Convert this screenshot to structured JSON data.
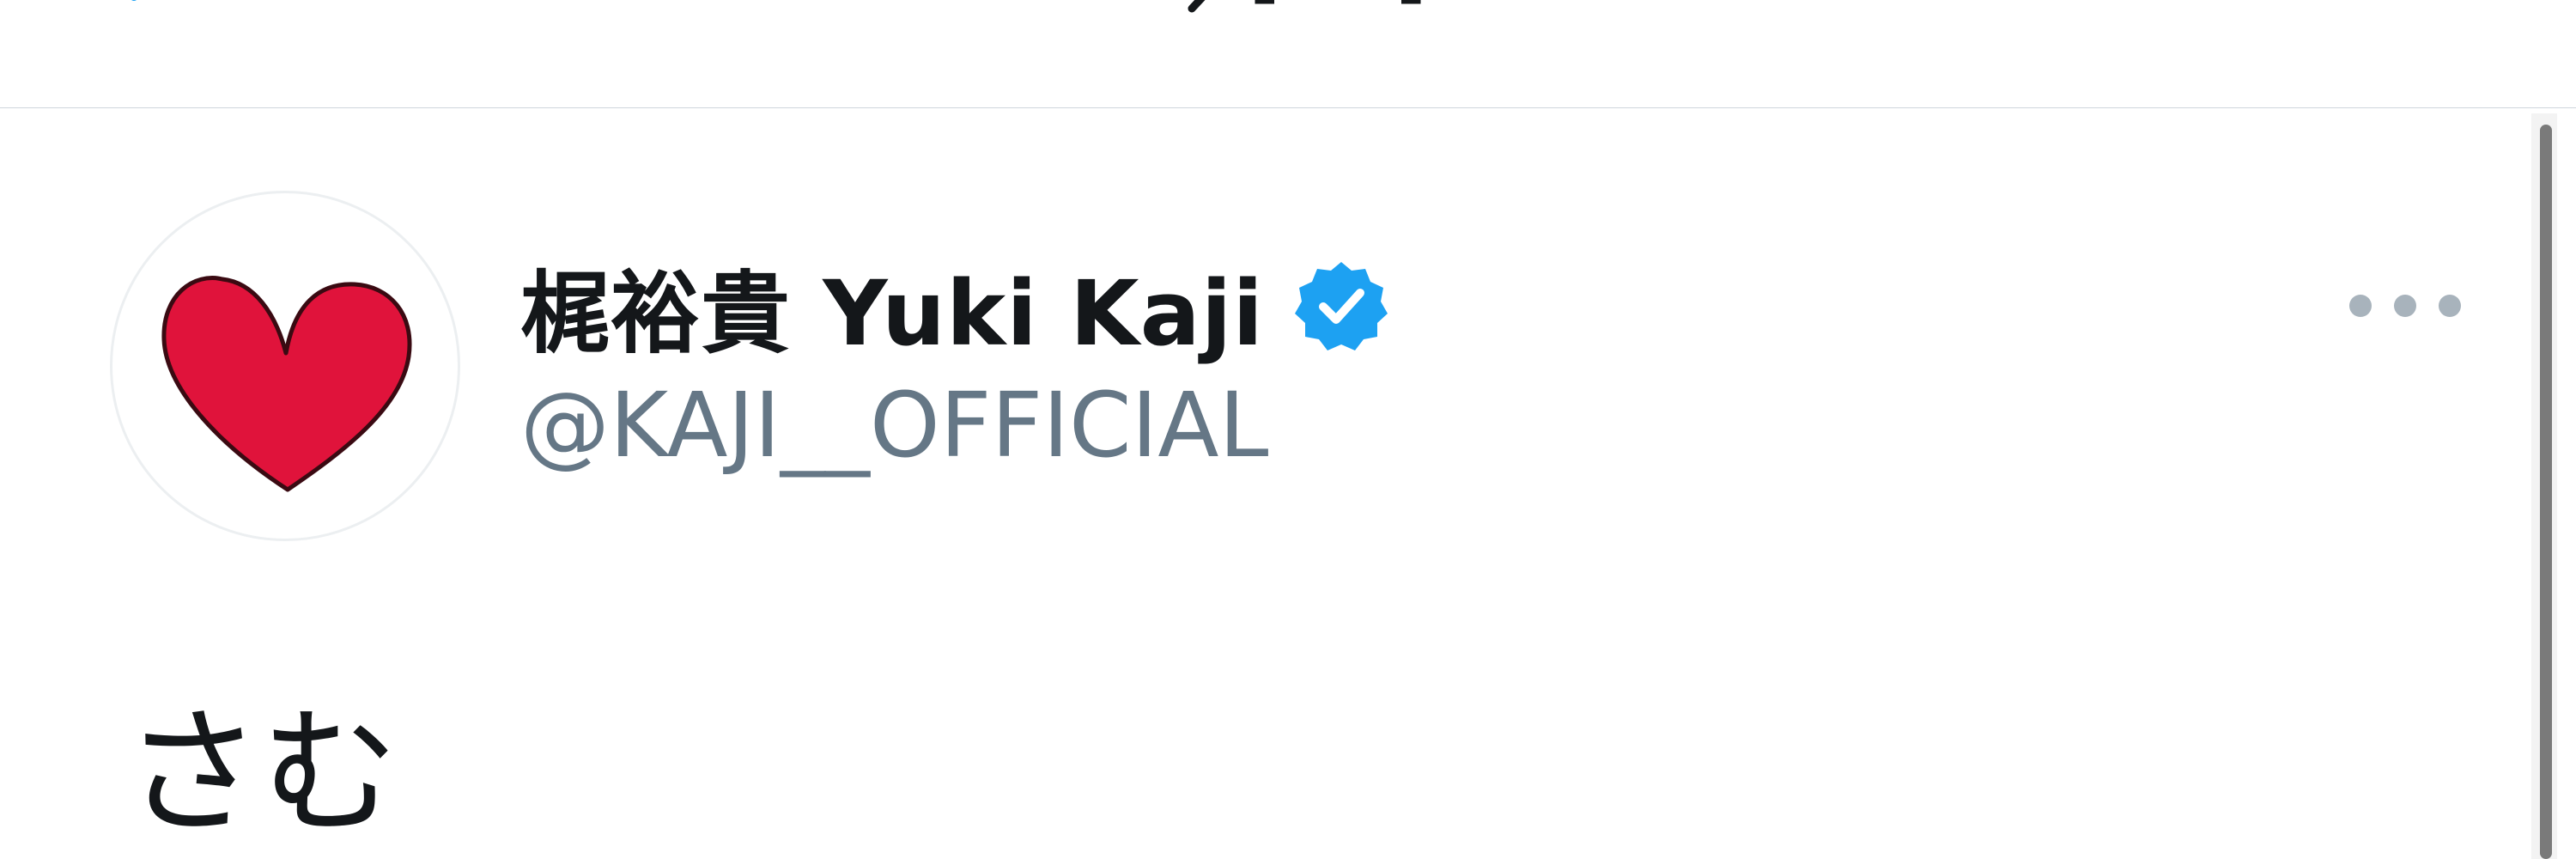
{
  "nav": {
    "back_icon": "chevron-left-icon",
    "accent_color": "#1da1f2"
  },
  "tweet": {
    "avatar_icon": "red-heart-icon",
    "heart_color": "#e0133b",
    "display_name": "梶裕貴 Yuki Kaji",
    "verified_icon": "verified-badge-icon",
    "verified_color": "#1da1f2",
    "handle": "@KAJI__OFFICIAL",
    "more_icon": "more-options-icon",
    "text": "さむ"
  }
}
